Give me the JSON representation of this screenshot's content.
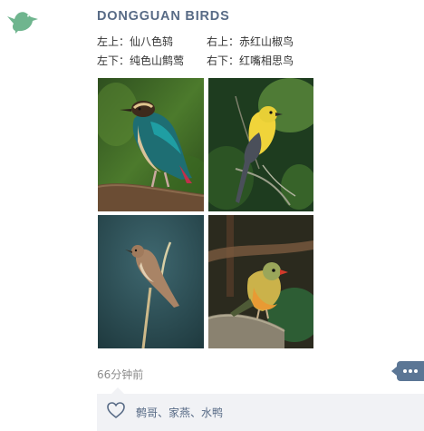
{
  "post": {
    "author": "DONGGUAN BIRDS",
    "captions": {
      "top_left": "左上：仙八色鸫",
      "top_right": "右上：赤红山椒鸟",
      "bottom_left": "左下：纯色山鹪莺",
      "bottom_right": "右下：红嘴相思鸟"
    },
    "photos": [
      {
        "icon": "fairy-pitta-photo"
      },
      {
        "icon": "scarlet-minivet-photo"
      },
      {
        "icon": "plain-prinia-photo"
      },
      {
        "icon": "red-billed-leiothrix-photo"
      }
    ],
    "timestamp": "66分钟前",
    "likes": "鹩哥、家燕、水鸭"
  },
  "colors": {
    "title": "#586b86",
    "comment_button": "#5b7695",
    "likes_bg": "#f1f2f5",
    "logo_bird": "#6fb58e"
  },
  "icons": {
    "logo": "bird-logo-icon",
    "comment": "comment-dots-icon",
    "like": "heart-icon"
  }
}
